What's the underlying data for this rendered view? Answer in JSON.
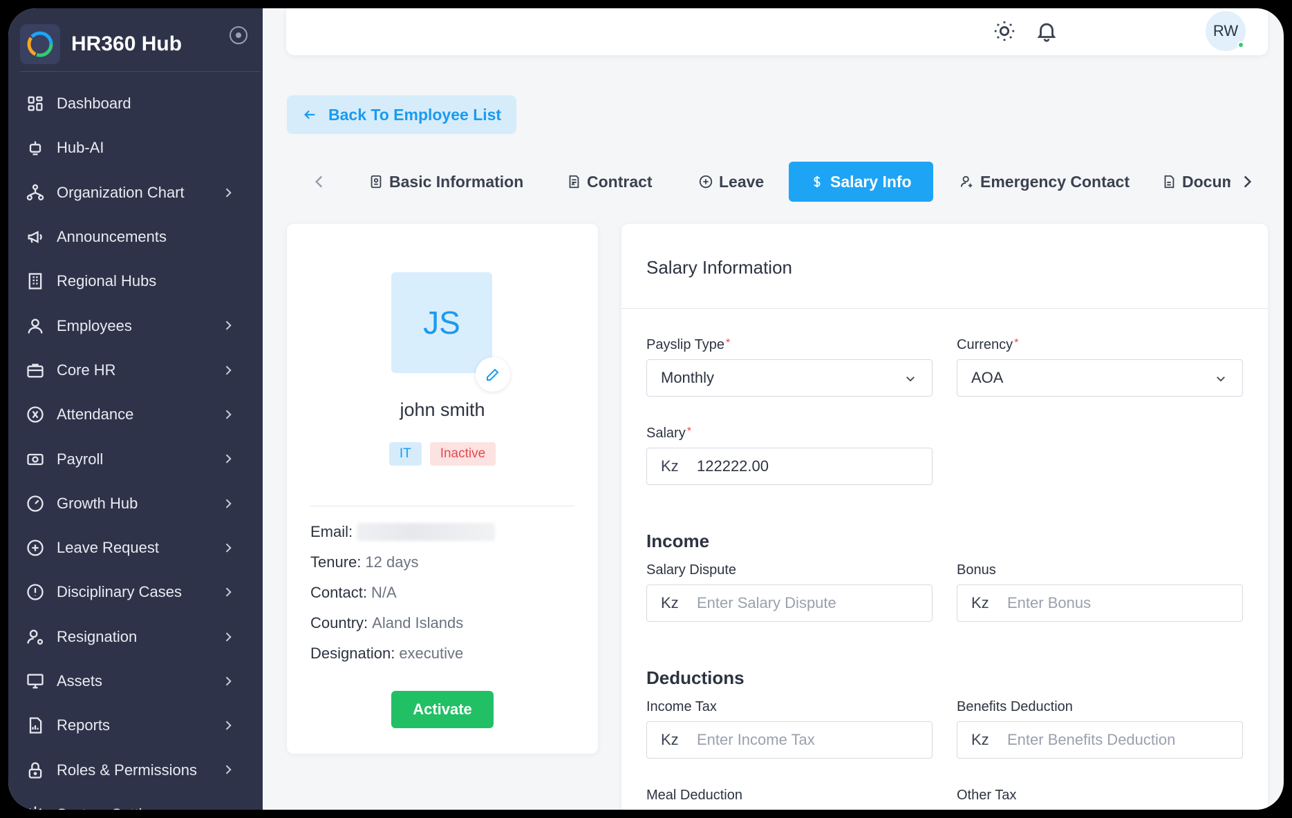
{
  "app": {
    "name": "HR360 Hub"
  },
  "sidebar": {
    "items": [
      {
        "label": "Dashboard",
        "icon": "dashboard-icon",
        "chevron": false
      },
      {
        "label": "Hub-AI",
        "icon": "robot-icon",
        "chevron": false
      },
      {
        "label": "Organization Chart",
        "icon": "org-chart-icon",
        "chevron": true
      },
      {
        "label": "Announcements",
        "icon": "megaphone-icon",
        "chevron": false
      },
      {
        "label": "Regional Hubs",
        "icon": "building-icon",
        "chevron": false
      },
      {
        "label": "Employees",
        "icon": "user-icon",
        "chevron": true
      },
      {
        "label": "Core HR",
        "icon": "briefcase-icon",
        "chevron": true
      },
      {
        "label": "Attendance",
        "icon": "attendance-icon",
        "chevron": true
      },
      {
        "label": "Payroll",
        "icon": "cash-icon",
        "chevron": true
      },
      {
        "label": "Growth Hub",
        "icon": "gauge-icon",
        "chevron": true
      },
      {
        "label": "Leave Request",
        "icon": "plus-circle-icon",
        "chevron": true
      },
      {
        "label": "Disciplinary Cases",
        "icon": "alert-circle-icon",
        "chevron": true
      },
      {
        "label": "Resignation",
        "icon": "user-settings-icon",
        "chevron": true
      },
      {
        "label": "Assets",
        "icon": "monitor-icon",
        "chevron": true
      },
      {
        "label": "Reports",
        "icon": "report-icon",
        "chevron": true
      },
      {
        "label": "Roles & Permissions",
        "icon": "lock-icon",
        "chevron": true
      },
      {
        "label": "System Settings",
        "icon": "gear-icon",
        "chevron": true
      }
    ]
  },
  "topbar": {
    "avatar_initials": "RW"
  },
  "back_button": {
    "label": "Back To Employee List"
  },
  "tabs": [
    {
      "label": "Basic Information",
      "icon": "id-card-icon",
      "active": false
    },
    {
      "label": "Contract",
      "icon": "contract-icon",
      "active": false
    },
    {
      "label": "Leave",
      "icon": "plus-circle-icon",
      "active": false
    },
    {
      "label": "Salary Info",
      "icon": "dollar-icon",
      "active": true
    },
    {
      "label": "Emergency Contact",
      "icon": "user-plus-icon",
      "active": false
    },
    {
      "label": "Documents",
      "icon": "document-icon",
      "active": false
    }
  ],
  "profile": {
    "initials": "JS",
    "name": "john smith",
    "department": "IT",
    "status": "Inactive",
    "email_label": "Email:",
    "tenure_label": "Tenure:",
    "tenure": "12 days",
    "contact_label": "Contact:",
    "contact": "N/A",
    "country_label": "Country:",
    "country": "Aland Islands",
    "designation_label": "Designation:",
    "designation": "executive",
    "activate_label": "Activate"
  },
  "salary": {
    "title": "Salary Information",
    "payslip_type_label": "Payslip Type",
    "payslip_type": "Monthly",
    "currency_label": "Currency",
    "currency": "AOA",
    "salary_label": "Salary",
    "currency_prefix": "Kz",
    "salary_value": "122222.00",
    "income_title": "Income",
    "salary_dispute_label": "Salary Dispute",
    "salary_dispute_placeholder": "Enter Salary Dispute",
    "bonus_label": "Bonus",
    "bonus_placeholder": "Enter Bonus",
    "deductions_title": "Deductions",
    "income_tax_label": "Income Tax",
    "income_tax_placeholder": "Enter Income Tax",
    "benefits_deduction_label": "Benefits Deduction",
    "benefits_deduction_placeholder": "Enter Benefits Deduction",
    "meal_deduction_label": "Meal Deduction",
    "other_tax_label": "Other Tax"
  },
  "colors": {
    "sidebar_bg": "#2e3349",
    "accent": "#1ea4f5",
    "success": "#22c065",
    "danger": "#e5484d"
  }
}
